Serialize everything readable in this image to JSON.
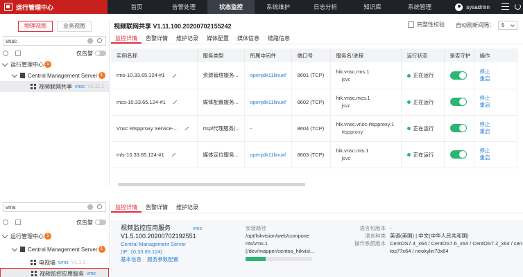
{
  "topbar": {
    "app_title": "运行管理中心",
    "nav": [
      "首页",
      "告警处理",
      "状态监控",
      "系统维护",
      "日志分析",
      "知识库",
      "系统管理"
    ],
    "active_nav": "状态监控",
    "username": "sysadmin"
  },
  "top_panel": {
    "sidebar": {
      "tabs": [
        "物理视图",
        "业务视图"
      ],
      "search_value": "vnsc",
      "only_alarm_label": "仅告警",
      "tree": [
        {
          "label": "运行管理中心",
          "badge": "1"
        },
        {
          "label": "Central Management Server",
          "badge": "1"
        },
        {
          "label": "视频联网共享",
          "tag": "vnsc",
          "version": "V1.11.1"
        }
      ]
    },
    "main": {
      "title": "视频联网共享 V1.11.100.20200702155242",
      "check_label": "完整性校验",
      "refresh_label": "自动刷新间隔：",
      "refresh_value": "5",
      "tabs": [
        "监控详情",
        "告警详情",
        "维护记录",
        "媒体配置",
        "媒体信息",
        "链路信息"
      ],
      "columns": [
        "实例名称",
        "服务类型",
        "所属中间件",
        "端口号",
        "服务名/进程",
        "运行状态",
        "是否守护",
        "操作"
      ],
      "rows": [
        {
          "name": "rms-10.33.65.124-#1",
          "type": "资源管理服务...",
          "middleware": "openjdk11linuxf",
          "port": "8601 (TCP)",
          "proc1": "hik.vnsc.rms.1",
          "proc2": "jsvc",
          "status": "正在运行",
          "op1": "停止",
          "op2": "重启"
        },
        {
          "name": "mcs-10.33.65.124-#1",
          "type": "媒体配置服务...",
          "middleware": "openjdk11linuxf",
          "port": "8602 (TCP)",
          "proc1": "hik.vnsc.mcs.1",
          "proc2": "jsvc",
          "status": "正在运行",
          "op1": "停止",
          "op2": "重启"
        },
        {
          "name": "Vnsc Rtspproxy Service-...",
          "type": "rtspf代理服务(...",
          "middleware": "-",
          "port": "8604 (TCP)",
          "proc1": "hik.vnsc.vnsc-rtspproxy.1",
          "proc2": "rtspproxy",
          "status": "正在运行",
          "op1": "停止",
          "op2": "重启"
        },
        {
          "name": "mls-10.33.65.124-#1",
          "type": "媒体定位服务...",
          "middleware": "openjdk11linuxf",
          "port": "8603 (TCP)",
          "proc1": "hik.vnsc.mls.1",
          "proc2": "jsvc",
          "status": "正在运行",
          "op1": "停止",
          "op2": "重启"
        }
      ]
    }
  },
  "bottom_panel": {
    "sidebar": {
      "search_value": "vms",
      "only_alarm_label": "仅告警",
      "tree": [
        {
          "label": "运行管理中心",
          "badge": "1"
        },
        {
          "label": "Central Management Server",
          "badge": "1"
        },
        {
          "label": "电视墙",
          "tag": "tvms",
          "version": "V1.1.1"
        },
        {
          "label": "视频监控应用服务",
          "tag": "vms"
        }
      ]
    },
    "main": {
      "tabs": [
        "监控详情",
        "告警详情",
        "维护记录"
      ],
      "service_name": "视频监控应用服务",
      "service_tag": "vms",
      "service_version": "V1.5.100.20200702192551",
      "server_name": "Central Management Server",
      "server_ip": "(IP: 10.33.65.124)",
      "link_basic": "基本信息",
      "link_params": "服务参数配置",
      "path_label": "安装路径",
      "path_value_1": "/opt/hikvision/web/compone",
      "path_value_2": "nts/vms.1",
      "path_value_3": "(/dev/mapper/centos_hikvisi...",
      "disk_usage": 0.3,
      "lang_pack_label": "语言包版本",
      "lang_pack_value": "-",
      "lang_type_label": "语言种类",
      "lang_type_value": "英语(美国) | 中文(中华人民共和国)",
      "os_label": "操作系统版本",
      "os_value_1": "CentOS7.4_x64 / CentOS7.6_x64 / CentOS7.2_x64 / cen",
      "os_value_2": "tos77x64 / neokylin70x64"
    }
  }
}
